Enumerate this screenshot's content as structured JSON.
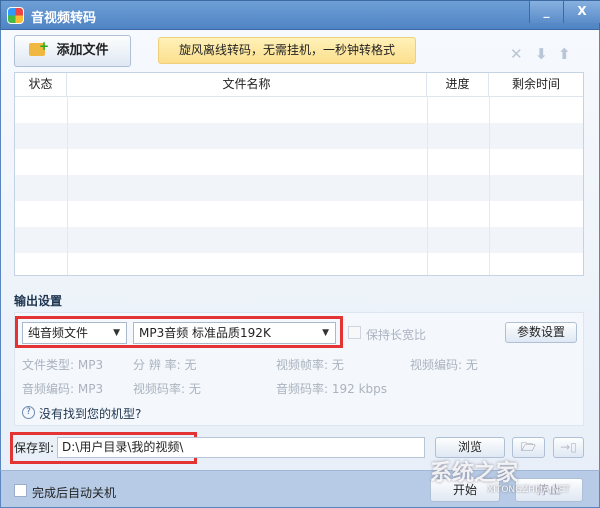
{
  "window": {
    "title": "音视频转码",
    "minimize": "_",
    "close": "X"
  },
  "toolbar": {
    "add_file": "添加文件",
    "banner": "旋风离线转码，无需挂机，一秒钟转格式",
    "delete_icon": "✕",
    "down_icon": "⬇",
    "up_icon": "⬆"
  },
  "table": {
    "headers": [
      "状态",
      "文件名称",
      "进度",
      "剩余时间"
    ],
    "rows": []
  },
  "output": {
    "section_label": "输出设置",
    "category": "纯音频文件",
    "preset": "MP3音频 标准品质192K",
    "keep_ratio": "保持长宽比",
    "params_button": "参数设置",
    "info": [
      {
        "label": "文件类型:",
        "value": "MP3"
      },
      {
        "label": "分 辨 率:",
        "value": "无"
      },
      {
        "label": "视频帧率:",
        "value": "无"
      },
      {
        "label": "视频编码:",
        "value": "无"
      },
      {
        "label": "音频编码:",
        "value": "MP3"
      },
      {
        "label": "视频码率:",
        "value": "无"
      },
      {
        "label": "音频码率:",
        "value": "192 kbps"
      }
    ],
    "help": "没有找到您的机型?"
  },
  "save": {
    "label": "保存到:",
    "path": "D:\\用户目录\\我的视频\\",
    "browse": "浏览"
  },
  "footer": {
    "auto_shutdown": "完成后自动关机",
    "start": "开始",
    "stop": "停止"
  },
  "watermark": {
    "text": "系统之家",
    "url": "XITONGZHIJIA.NET"
  }
}
